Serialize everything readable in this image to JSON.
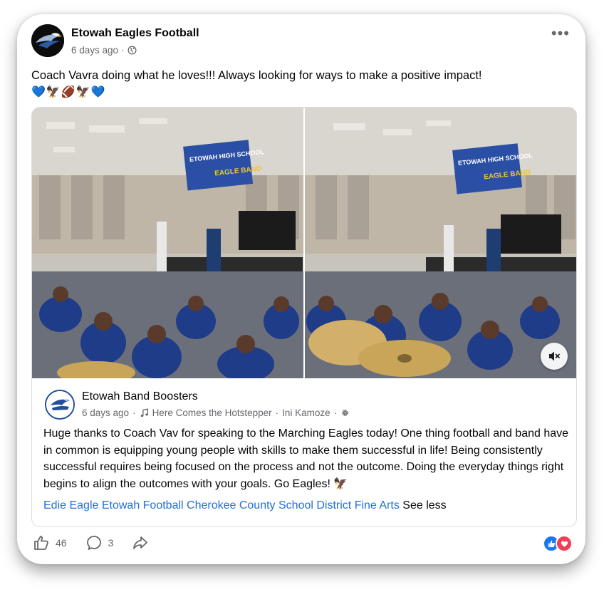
{
  "post": {
    "page_name": "Etowah Eagles Football",
    "time": "6 days ago",
    "separator": "·",
    "audience_icon": "globe-icon",
    "more_icon": "more-options-icon",
    "more_label": "•••",
    "caption": "Coach Vavra doing what he loves!!! Always looking for ways to make a positive impact!",
    "emoji_line": "💙🦅🏈🦅💙"
  },
  "shared_post": {
    "page_name": "Etowah Band Boosters",
    "time": "6 days ago",
    "music_icon": "music-note-icon",
    "song": "Here Comes the Hotstepper",
    "artist": "Ini Kamoze",
    "settings_icon": "gear-icon",
    "text": "Huge thanks to Coach Vav for speaking to the Marching Eagles today! One thing football and band have in common is equipping young people with skills to make them successful in life! Being consistently successful requires being focused on the process and not the outcome. Doing the everyday things right begins to align the outcomes with your goals. Go Eagles! 🦅",
    "tags": [
      "Edie Eagle",
      "Etowah Football",
      "Cherokee County School District Fine Arts"
    ],
    "see_less": "See less",
    "photos": [
      {
        "banner_line1": "ETOWAH HIGH SCHOOL",
        "banner_line2": "EAGLE BAND"
      },
      {
        "banner_line1": "ETOWAH HIGH SCHOOL",
        "banner_line2": "EAGLE BAND"
      }
    ],
    "mute_icon": "speaker-muted-icon"
  },
  "footer": {
    "like_count": "46",
    "comment_count": "3",
    "reactions": [
      "like",
      "love"
    ]
  },
  "colors": {
    "link": "#216fdb",
    "meta": "#65676b",
    "like": "#1877f2",
    "love": "#f33e58"
  }
}
